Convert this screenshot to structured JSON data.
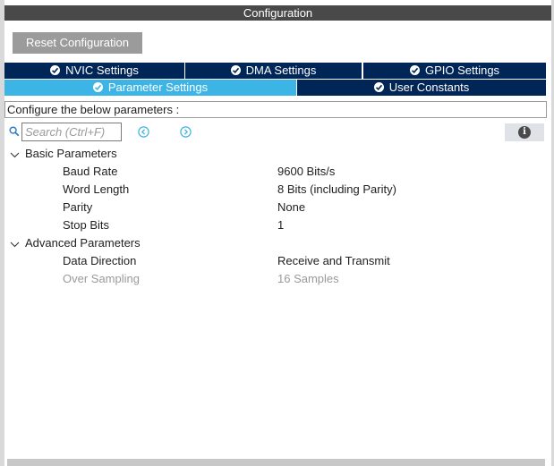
{
  "window": {
    "title": "Configuration"
  },
  "toolbar": {
    "reset_label": "Reset Configuration"
  },
  "tabs": [
    {
      "label": "NVIC Settings",
      "active": false
    },
    {
      "label": "DMA Settings",
      "active": false
    },
    {
      "label": "GPIO Settings",
      "active": false
    },
    {
      "label": "Parameter Settings",
      "active": true
    },
    {
      "label": "User Constants",
      "active": false
    }
  ],
  "description": "Configure the below parameters :",
  "search": {
    "placeholder": "Search (Ctrl+F)"
  },
  "groups": [
    {
      "label": "Basic Parameters",
      "params": [
        {
          "name": "Baud Rate",
          "value": "9600 Bits/s"
        },
        {
          "name": "Word Length",
          "value": "8 Bits (including Parity)"
        },
        {
          "name": "Parity",
          "value": "None"
        },
        {
          "name": "Stop Bits",
          "value": "1"
        }
      ]
    },
    {
      "label": "Advanced Parameters",
      "params": [
        {
          "name": "Data Direction",
          "value": "Receive and Transmit"
        },
        {
          "name": "Over Sampling",
          "value": "16 Samples",
          "disabled": true
        }
      ]
    }
  ],
  "colors": {
    "titlebar": "#494949",
    "tab": "#002657",
    "tab_active": "#3cb4e5",
    "button": "#9b9b9b",
    "nav_icon": "#3cb4e5"
  }
}
